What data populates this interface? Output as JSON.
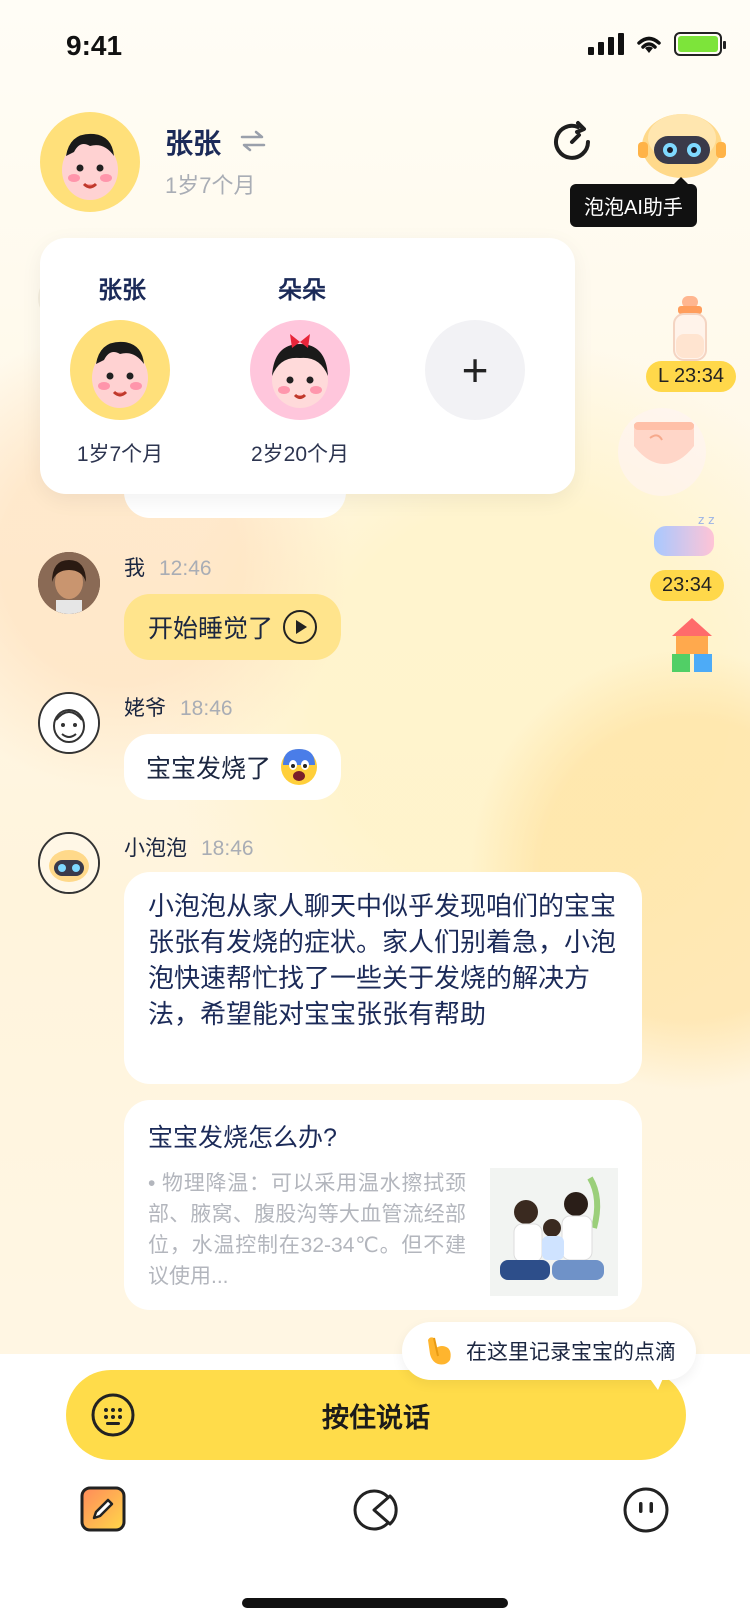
{
  "status": {
    "time": "9:41"
  },
  "header": {
    "baby_name": "张张",
    "baby_age": "1岁7个月",
    "ai_tooltip": "泡泡AI助手"
  },
  "switcher": {
    "babies": [
      {
        "name": "张张",
        "age": "1岁7个月"
      },
      {
        "name": "朵朵",
        "age": "2岁20个月"
      }
    ],
    "add_label": "+"
  },
  "floating": {
    "bottle_time": "L 23:34",
    "sleep_time": "23:34"
  },
  "messages": [
    {
      "sender": "我",
      "time": "12:46",
      "text": "开始睡觉了"
    },
    {
      "sender": "姥爷",
      "time": "18:46",
      "text": "宝宝发烧了"
    },
    {
      "sender": "小泡泡",
      "time": "18:46",
      "text": "小泡泡从家人聊天中似乎发现咱们的宝宝张张有发烧的症状。家人们别着急，小泡泡快速帮忙找了一些关于发烧的解决方法，希望能对宝宝张张有帮助"
    }
  ],
  "article": {
    "title": "宝宝发烧怎么办?",
    "body": "•  物理降温：可以采用温水擦拭颈部、腋窝、腹股沟等大血管流经部位，水温控制在32-34℃。但不建议使用..."
  },
  "bottom": {
    "hint": "在这里记录宝宝的点滴",
    "talk_label": "按住说话"
  },
  "icons": [
    "signal-icon",
    "wifi-icon",
    "battery-icon",
    "swap-icon",
    "history-icon",
    "robot-icon",
    "bottle-icon",
    "diaper-icon",
    "pillow-icon",
    "blocks-icon",
    "play-icon",
    "keyboard-icon",
    "pencil-icon",
    "chart-icon",
    "face-icon",
    "pointing-hand-icon",
    "fear-emoji-icon"
  ],
  "colors": {
    "accent": "#ffdc4a",
    "bubble_me": "#ffe48c",
    "text_dark": "#1b2a58"
  }
}
